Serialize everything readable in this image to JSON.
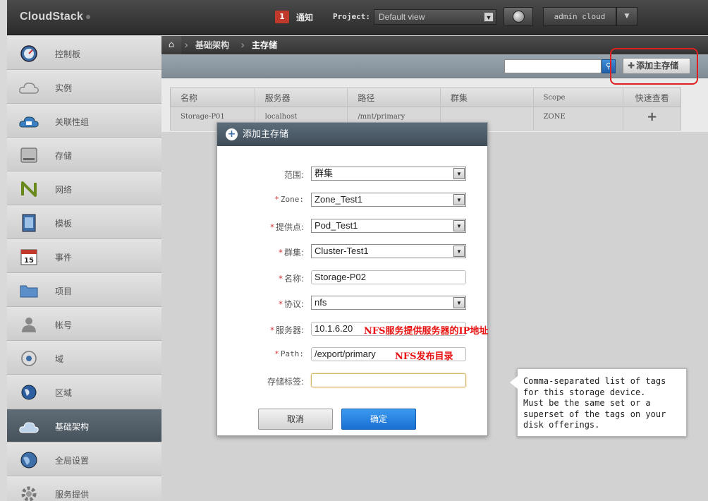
{
  "header": {
    "brand": "CloudStack",
    "notification_count": "1",
    "notification_label": "通知",
    "project_label": "Project:",
    "project_value": "Default view",
    "user_label": "admin cloud"
  },
  "sidebar": {
    "items": [
      {
        "label": "控制板",
        "icon": "dashboard-icon"
      },
      {
        "label": "实例",
        "icon": "cloud-icon"
      },
      {
        "label": "关联性组",
        "icon": "affinity-cloud-icon"
      },
      {
        "label": "存储",
        "icon": "storage-icon"
      },
      {
        "label": "网络",
        "icon": "network-icon"
      },
      {
        "label": "模板",
        "icon": "template-icon"
      },
      {
        "label": "事件",
        "icon": "calendar-icon"
      },
      {
        "label": "项目",
        "icon": "folder-icon"
      },
      {
        "label": "帐号",
        "icon": "user-icon"
      },
      {
        "label": "域",
        "icon": "domain-icon"
      },
      {
        "label": "区域",
        "icon": "region-globe-icon"
      },
      {
        "label": "基础架构",
        "icon": "infrastructure-icon",
        "active": true
      },
      {
        "label": "全局设置",
        "icon": "global-settings-icon"
      },
      {
        "label": "服务提供",
        "icon": "service-gear-icon"
      }
    ]
  },
  "breadcrumb": {
    "items": [
      "基础架构",
      "主存储"
    ]
  },
  "toolbar": {
    "search_value": "",
    "add_button": "添加主存储"
  },
  "table": {
    "columns": [
      "名称",
      "服务器",
      "路径",
      "群集",
      "Scope",
      "快速查看"
    ],
    "rows": [
      [
        "Storage-P01",
        "localhost",
        "/mnt/primary",
        "",
        "ZONE",
        "+"
      ]
    ]
  },
  "dialog": {
    "title": "添加主存储",
    "fields": {
      "scope": {
        "label": "范围:",
        "value": "群集"
      },
      "zone": {
        "label": "Zone:",
        "value": "Zone_Test1"
      },
      "pod": {
        "label": "提供点:",
        "value": "Pod_Test1"
      },
      "cluster": {
        "label": "群集:",
        "value": "Cluster-Test1"
      },
      "name": {
        "label": "名称:",
        "value": "Storage-P02"
      },
      "protocol": {
        "label": "协议:",
        "value": "nfs"
      },
      "server": {
        "label": "服务器:",
        "value": "10.1.6.20"
      },
      "path": {
        "label": "Path:",
        "value": "/export/primary"
      },
      "tags": {
        "label": "存储标签:",
        "value": ""
      }
    },
    "annotations": {
      "server": "NFS服务提供服务器的IP地址",
      "path": "NFS发布目录"
    },
    "cancel": "取消",
    "confirm": "确定"
  },
  "tooltip": {
    "lines": [
      "Comma-separated list of tags",
      "for this storage device.",
      "Must be the same set or a",
      "superset of the tags on your",
      "disk offerings."
    ]
  },
  "colors": {
    "accent_blue": "#1a6fd1",
    "required_red": "#d23a3a",
    "annotation_red": "#e81010"
  }
}
